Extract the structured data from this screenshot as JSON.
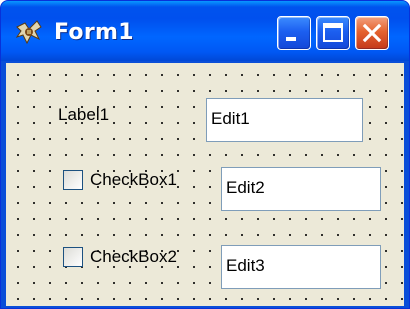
{
  "window": {
    "title": "Form1",
    "icon": "delphi-app-icon",
    "buttons": {
      "minimize": "minimize-icon",
      "maximize": "maximize-icon",
      "close": "close-icon"
    }
  },
  "form": {
    "label1": "Label1",
    "edits": [
      {
        "value": "Edit1"
      },
      {
        "value": "Edit2"
      },
      {
        "value": "Edit3"
      }
    ],
    "checkboxes": [
      {
        "label": "CheckBox1",
        "checked": false
      },
      {
        "label": "CheckBox2",
        "checked": false
      }
    ]
  },
  "colors": {
    "titlebar": "#0058f4",
    "client_bg": "#ece9d8",
    "close_button": "#e5632f",
    "edit_border": "#7f9db9"
  }
}
